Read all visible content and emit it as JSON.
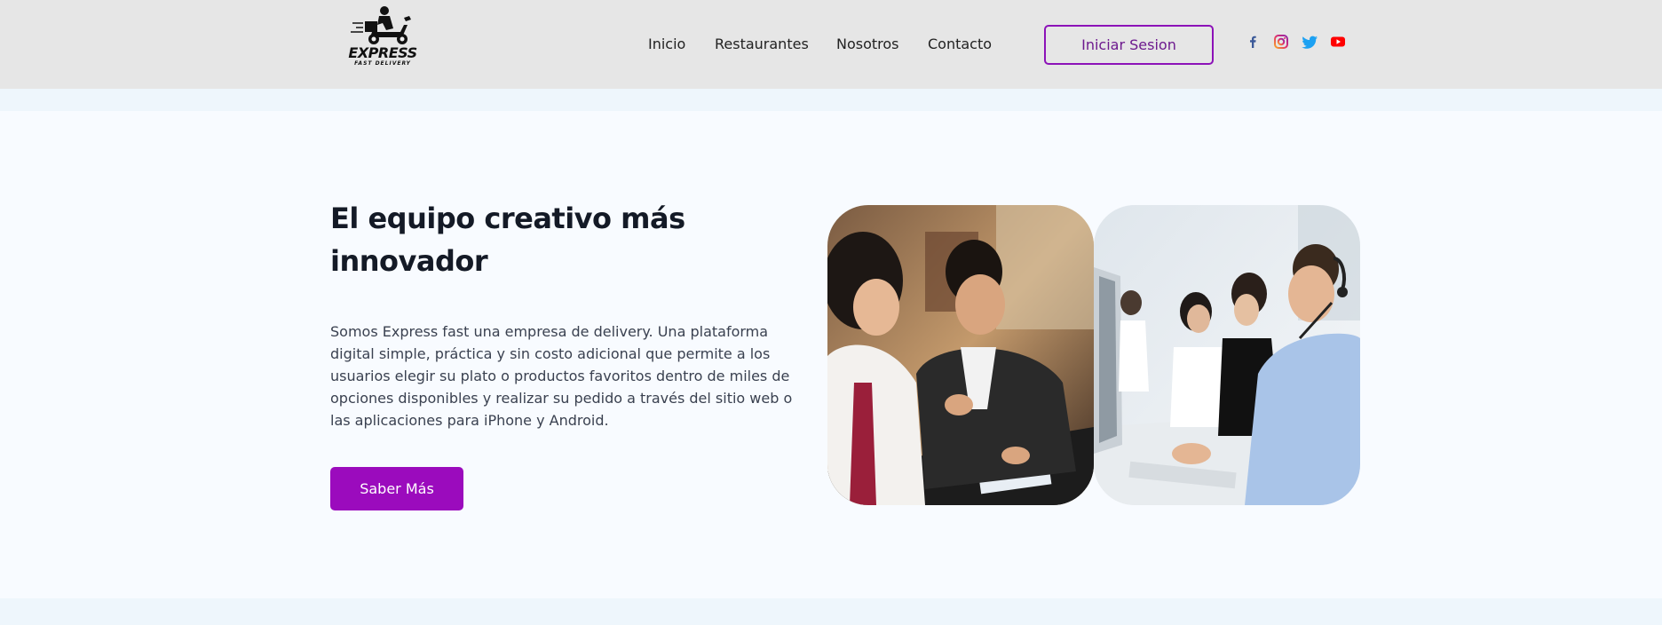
{
  "header": {
    "logo": {
      "name": "EXPRESS",
      "tagline": "FAST DELIVERY",
      "icon": "scooter-rider-icon"
    },
    "nav": [
      {
        "label": "Inicio"
      },
      {
        "label": "Restaurantes"
      },
      {
        "label": "Nosotros"
      },
      {
        "label": "Contacto"
      }
    ],
    "login_label": "Iniciar Sesion",
    "social": [
      {
        "name": "facebook-icon",
        "color": "#3b5998"
      },
      {
        "name": "instagram-icon",
        "color": "#e1306c"
      },
      {
        "name": "twitter-icon",
        "color": "#1da1f2"
      },
      {
        "name": "youtube-icon",
        "color": "#ff0000"
      }
    ]
  },
  "hero": {
    "title_line1": "El equipo creativo más",
    "title_line2": "innovador",
    "body": "Somos Express fast una empresa de delivery. Una plataforma digital simple, práctica y sin costo adicional que permite a los usuarios elegir su plato o productos favoritos dentro de miles de opciones disponibles y realizar su pedido a través del sitio web o las aplicaciones para iPhone y Android.",
    "cta_label": "Saber Más",
    "images": [
      {
        "name": "team-meeting-photo"
      },
      {
        "name": "call-center-photo"
      }
    ]
  },
  "colors": {
    "header_bg": "#e6e6e6",
    "accent": "#9b0bbd",
    "page_bg": "#eef6fc",
    "section_bg": "#f8fbff"
  }
}
